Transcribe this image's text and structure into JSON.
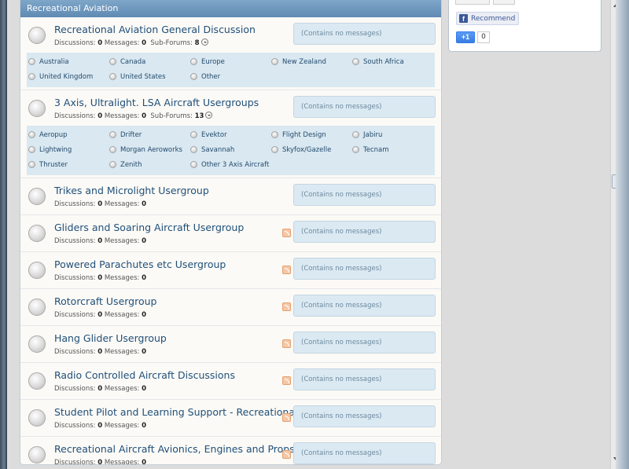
{
  "sidebar": {
    "recommend_label": "Recommend",
    "fb_letter": "f",
    "gplus_label": "+1",
    "gplus_count": "0"
  },
  "category": {
    "title": "Recreational Aviation"
  },
  "labels": {
    "discussions": "Discussions:",
    "messages": "Messages:",
    "subforums": "Sub-Forums:",
    "no_messages": "(Contains no messages)"
  },
  "nodes": [
    {
      "title": "Recreational Aviation General Discussion",
      "discussions": "0",
      "messages": "0",
      "subforum_count": "8",
      "rss": false,
      "subforums": [
        "Australia",
        "Canada",
        "Europe",
        "New Zealand",
        "South Africa",
        "United Kingdom",
        "United States",
        "Other"
      ]
    },
    {
      "title": "3 Axis, Ultralight. LSA Aircraft Usergroups",
      "discussions": "0",
      "messages": "0",
      "subforum_count": "13",
      "rss": false,
      "subforums": [
        "Aeropup",
        "Drifter",
        "Evektor",
        "Flight Design",
        "Jabiru",
        "Lightwing",
        "Morgan Aeroworks",
        "Savannah",
        "Skyfox/Gazelle",
        "Tecnam",
        "Thruster",
        "Zenith",
        "Other 3 Axis Aircraft"
      ]
    },
    {
      "title": "Trikes and Microlight Usergroup",
      "discussions": "0",
      "messages": "0",
      "rss": false
    },
    {
      "title": "Gliders and Soaring Aircraft Usergroup",
      "discussions": "0",
      "messages": "0",
      "rss": true
    },
    {
      "title": "Powered Parachutes etc Usergroup",
      "discussions": "0",
      "messages": "0",
      "rss": true
    },
    {
      "title": "Rotorcraft Usergroup",
      "discussions": "0",
      "messages": "0",
      "rss": true
    },
    {
      "title": "Hang Glider Usergroup",
      "discussions": "0",
      "messages": "0",
      "rss": true
    },
    {
      "title": "Radio Controlled Aircraft Discussions",
      "discussions": "0",
      "messages": "0",
      "rss": true
    },
    {
      "title": "Student Pilot and Learning Support - Recreational",
      "discussions": "0",
      "messages": "0",
      "rss": true
    },
    {
      "title": "Recreational Aircraft Avionics, Engines and Props",
      "discussions": "0",
      "messages": "0",
      "rss": true
    }
  ]
}
